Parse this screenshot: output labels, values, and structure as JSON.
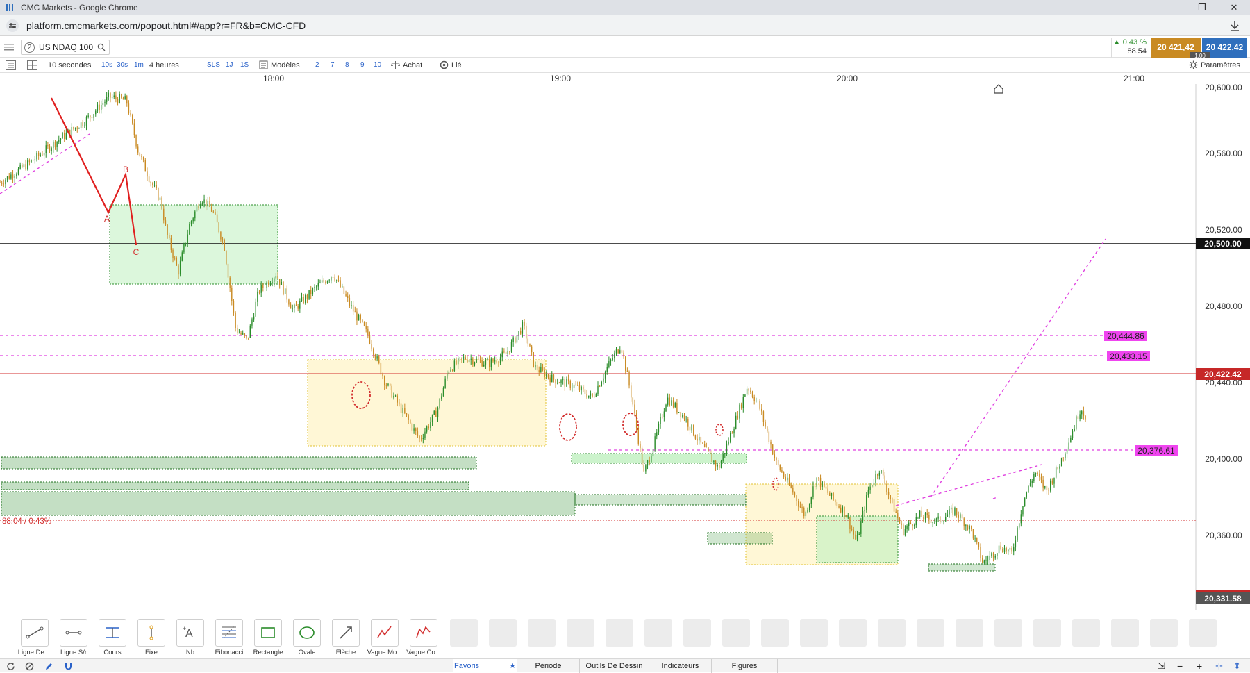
{
  "browser": {
    "title": "CMC Markets - Google Chrome",
    "url": "platform.cmcmarkets.com/popout.html#/app?r=FR&b=CMC-CFD",
    "controls": [
      "—",
      "❐",
      "✕"
    ]
  },
  "symbol": {
    "badge": "2",
    "name": "US NDAQ 100",
    "change_pct": "▲ 0.43 %",
    "change_pts": "88.54",
    "sell_price": "20 421,42",
    "buy_price": "20 422,42",
    "spread": "1.00"
  },
  "toolbar": {
    "interval": "10 secondes",
    "quick_intervals": [
      "10s",
      "30s",
      "1m"
    ],
    "range": "4 heures",
    "quick_ranges": [
      "SLS",
      "1J",
      "1S"
    ],
    "templates": "Modèles",
    "numbers": [
      "2",
      "7",
      "8",
      "9",
      "10"
    ],
    "achat": "Achat",
    "lie": "Lié",
    "parametres": "Paramètres"
  },
  "time_axis": [
    "18:00",
    "19:00",
    "20:00",
    "21:00"
  ],
  "price_axis": [
    "20,600.00",
    "20,560.00",
    "20,520.00",
    "20,480.00",
    "20,440.00",
    "20,400.00",
    "20,360.00"
  ],
  "price_tags": {
    "level_500": "20,500.00",
    "current": "20,422.42",
    "last": "20,331.58",
    "line_444": "20,444.86",
    "line_433": "20,433.15",
    "line_376": "20,376.61",
    "daily_change": "88.04 / 0.43%"
  },
  "wave_labels": [
    "A",
    "B",
    "C"
  ],
  "colors": {
    "up_candle": "#2a8c2a",
    "down_candle": "#c98a22",
    "magenta": "#e040e0",
    "red": "#d32f2f",
    "green_zone": "#bff0bf",
    "yellow_zone": "#fff3c4"
  },
  "chart_data": {
    "type": "candlestick",
    "instrument": "US NDAQ 100",
    "interval": "10 secondes",
    "y_range": [
      20320,
      20615
    ],
    "x_range": [
      "17:45",
      "21:13"
    ],
    "close_series": [
      {
        "t": "17:45",
        "p": 20545
      },
      {
        "t": "17:50",
        "p": 20555
      },
      {
        "t": "17:55",
        "p": 20567
      },
      {
        "t": "18:00",
        "p": 20578
      },
      {
        "t": "18:04",
        "p": 20590
      },
      {
        "t": "18:07",
        "p": 20588
      },
      {
        "t": "18:09",
        "p": 20562
      },
      {
        "t": "18:11",
        "p": 20547
      },
      {
        "t": "18:13",
        "p": 20535
      },
      {
        "t": "18:14",
        "p": 20518
      },
      {
        "t": "18:16",
        "p": 20498
      },
      {
        "t": "18:18",
        "p": 20523
      },
      {
        "t": "18:20",
        "p": 20537
      },
      {
        "t": "18:22",
        "p": 20530
      },
      {
        "t": "18:24",
        "p": 20512
      },
      {
        "t": "18:26",
        "p": 20468
      },
      {
        "t": "18:28",
        "p": 20462
      },
      {
        "t": "18:30",
        "p": 20488
      },
      {
        "t": "18:33",
        "p": 20497
      },
      {
        "t": "18:36",
        "p": 20478
      },
      {
        "t": "18:40",
        "p": 20490
      },
      {
        "t": "18:43",
        "p": 20497
      },
      {
        "t": "18:46",
        "p": 20480
      },
      {
        "t": "18:49",
        "p": 20465
      },
      {
        "t": "18:52",
        "p": 20440
      },
      {
        "t": "18:55",
        "p": 20425
      },
      {
        "t": "18:58",
        "p": 20410
      },
      {
        "t": "19:01",
        "p": 20425
      },
      {
        "t": "19:03",
        "p": 20447
      },
      {
        "t": "19:06",
        "p": 20453
      },
      {
        "t": "19:10",
        "p": 20450
      },
      {
        "t": "19:13",
        "p": 20455
      },
      {
        "t": "19:16",
        "p": 20470
      },
      {
        "t": "19:18",
        "p": 20448
      },
      {
        "t": "19:21",
        "p": 20442
      },
      {
        "t": "19:25",
        "p": 20438
      },
      {
        "t": "19:28",
        "p": 20432
      },
      {
        "t": "19:31",
        "p": 20450
      },
      {
        "t": "19:33",
        "p": 20460
      },
      {
        "t": "19:35",
        "p": 20430
      },
      {
        "t": "19:37",
        "p": 20392
      },
      {
        "t": "19:39",
        "p": 20410
      },
      {
        "t": "19:41",
        "p": 20432
      },
      {
        "t": "19:44",
        "p": 20422
      },
      {
        "t": "19:47",
        "p": 20407
      },
      {
        "t": "19:50",
        "p": 20395
      },
      {
        "t": "19:52",
        "p": 20412
      },
      {
        "t": "19:55",
        "p": 20438
      },
      {
        "t": "19:57",
        "p": 20428
      },
      {
        "t": "20:00",
        "p": 20398
      },
      {
        "t": "20:03",
        "p": 20382
      },
      {
        "t": "20:05",
        "p": 20370
      },
      {
        "t": "20:07",
        "p": 20390
      },
      {
        "t": "20:10",
        "p": 20378
      },
      {
        "t": "20:12",
        "p": 20372
      },
      {
        "t": "20:14",
        "p": 20356
      },
      {
        "t": "20:16",
        "p": 20383
      },
      {
        "t": "20:18",
        "p": 20395
      },
      {
        "t": "20:20",
        "p": 20378
      },
      {
        "t": "20:22",
        "p": 20362
      },
      {
        "t": "20:25",
        "p": 20370
      },
      {
        "t": "20:28",
        "p": 20367
      },
      {
        "t": "20:31",
        "p": 20373
      },
      {
        "t": "20:34",
        "p": 20362
      },
      {
        "t": "20:36",
        "p": 20345
      },
      {
        "t": "20:39",
        "p": 20354
      },
      {
        "t": "20:41",
        "p": 20350
      },
      {
        "t": "20:43",
        "p": 20378
      },
      {
        "t": "20:45",
        "p": 20393
      },
      {
        "t": "20:47",
        "p": 20383
      },
      {
        "t": "20:49",
        "p": 20395
      },
      {
        "t": "20:51",
        "p": 20410
      },
      {
        "t": "20:53",
        "p": 20427
      },
      {
        "t": "20:54",
        "p": 20421
      }
    ],
    "horizontal_levels": [
      20500.0,
      20444.86,
      20433.15,
      20422.42,
      20376.61,
      20331.58
    ]
  }
}
